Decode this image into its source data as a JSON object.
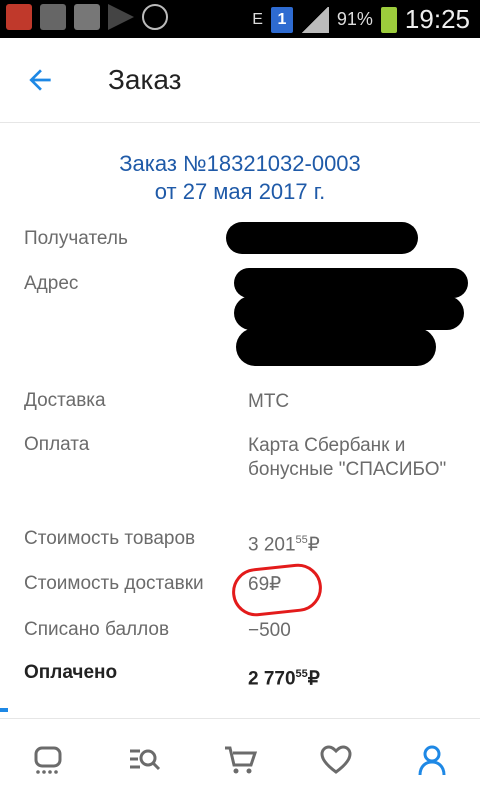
{
  "statusbar": {
    "time": "19:25",
    "battery_percent": "91%",
    "sim_label": "1",
    "network_letter": "E"
  },
  "appbar": {
    "title": "Заказ"
  },
  "order": {
    "header_line1": "Заказ №18321032-0003",
    "header_line2": "от 27 мая 2017 г.",
    "rows": {
      "recipient_label": "Получатель",
      "address_label": "Адрес",
      "delivery_label": "Доставка",
      "delivery_value": "МТС",
      "payment_label": "Оплата",
      "payment_value": "Карта Сбербанк и бонусные \"СПАСИБО\"",
      "goods_cost_label": "Стоимость товаров",
      "goods_cost_main": "3 201",
      "goods_cost_cents": "55",
      "delivery_cost_label": "Стоимость доставки",
      "delivery_cost_value": "69",
      "points_label": "Списано баллов",
      "points_value": "−500",
      "paid_label": "Оплачено",
      "paid_main": "2 770",
      "paid_cents": "55",
      "currency_symbol": "₽"
    }
  },
  "nav": {
    "active_color": "#1e88e5",
    "inactive_color": "#6b6b6b",
    "items": [
      "home-icon",
      "catalog-search-icon",
      "cart-icon",
      "favorites-heart-icon",
      "profile-icon"
    ]
  },
  "annotation_color": "#e31b1b"
}
